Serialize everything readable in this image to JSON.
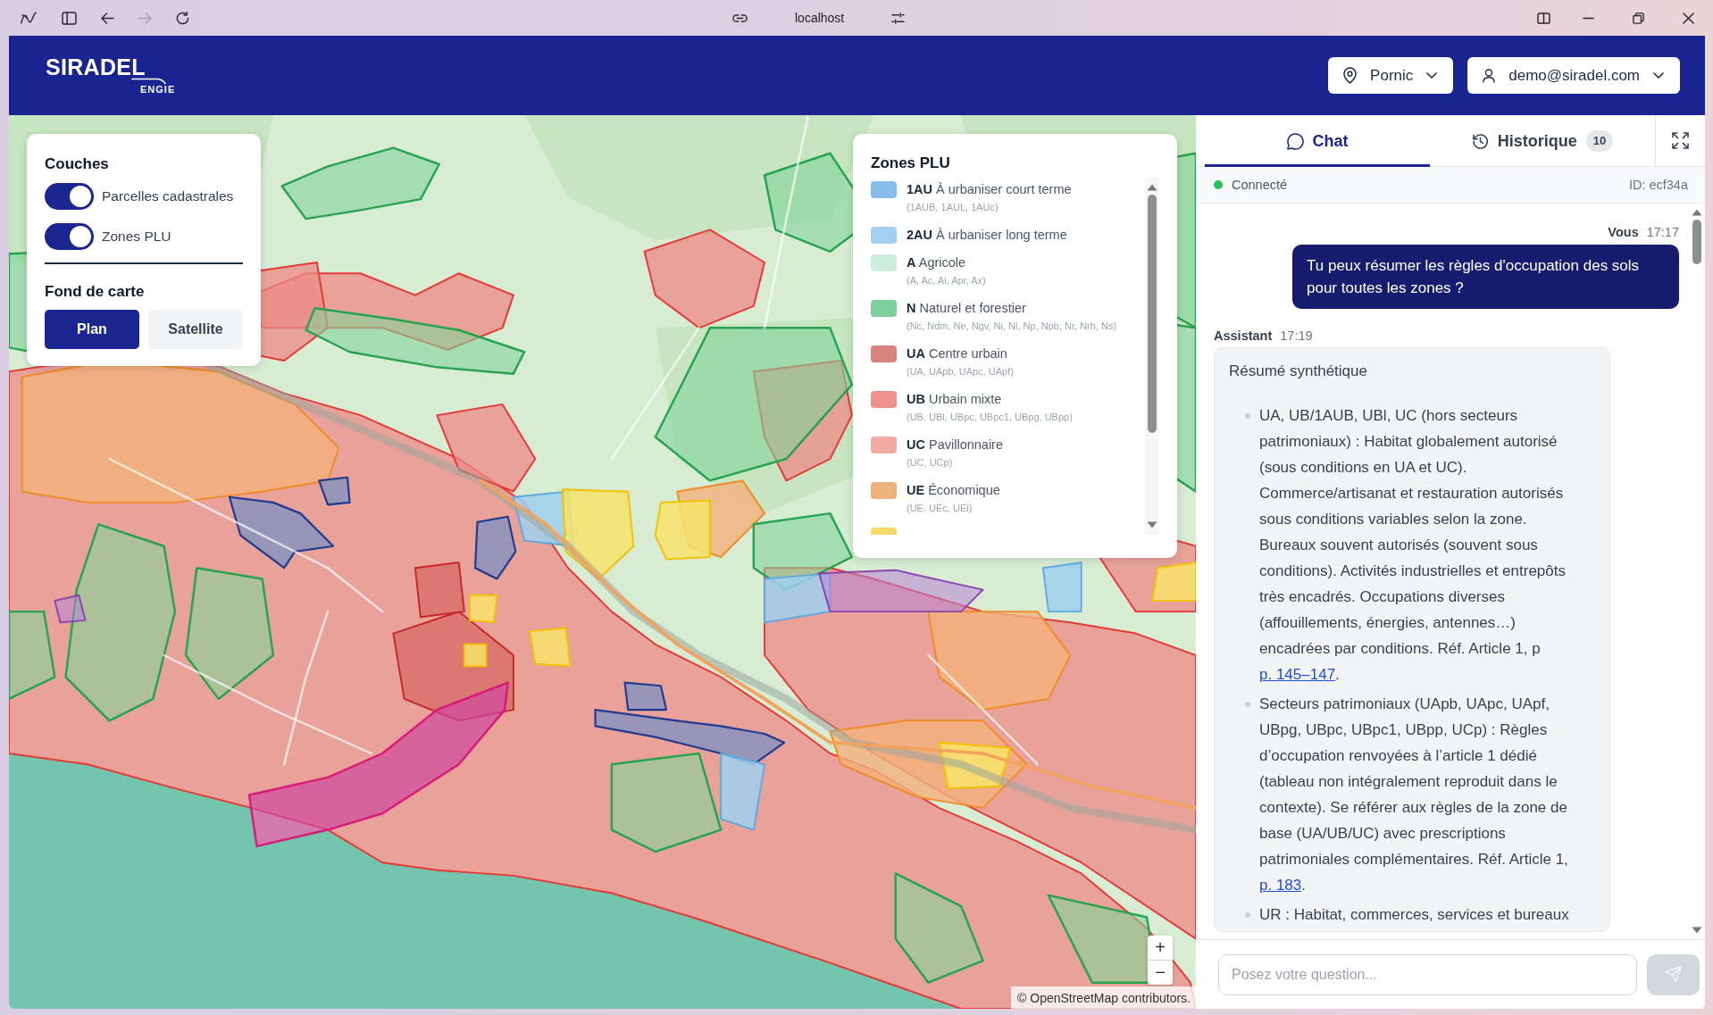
{
  "browser": {
    "address": "localhost",
    "can_go_forward": false
  },
  "header": {
    "logo": {
      "brand": "SIRADEL",
      "parent": "ENGIE"
    },
    "location": "Pornic",
    "user": "demo@siradel.com"
  },
  "layers_panel": {
    "title": "Couches",
    "layers": [
      {
        "label": "Parcelles cadastrales",
        "on": true
      },
      {
        "label": "Zones PLU",
        "on": true
      }
    ],
    "basemap_title": "Fond de carte",
    "basemaps": [
      {
        "label": "Plan",
        "selected": true
      },
      {
        "label": "Satellite",
        "selected": false
      }
    ]
  },
  "legend": {
    "title": "Zones PLU",
    "items": [
      {
        "label": "**1AU** À urbaniser court terme",
        "subzones": "(1AUB, 1AUL, 1AUc)",
        "color": "#86bee9"
      },
      {
        "label": "**2AU** À urbaniser long terme",
        "color": "#a3d0ef"
      },
      {
        "label": "**A** Agricole",
        "subzones": "(A, Ac, Ai, Apr, Ax)",
        "color": "#cdeedb"
      },
      {
        "label": "**N** Naturel et forestier",
        "subzones": "(Nc, Ndm, Ne, Ngv, Ni, Nl, Np, Npb, Nr, Nrh, Ns)",
        "color": "#7fcf9d"
      },
      {
        "label": "**UA** Centre urbain",
        "subzones": "(UA, UApb, UApc, UApf)",
        "color": "#d8847d"
      },
      {
        "label": "**UB** Urbain mixte",
        "subzones": "(UB, UBl, UBpc, UBpc1, UBpg, UBpp)",
        "color": "#ef918a"
      },
      {
        "label": "**UC** Pavillonnaire",
        "subzones": "(UC, UCp)",
        "color": "#f3aaa3"
      },
      {
        "label": "**UE** Économique",
        "subzones": "(UE, UEc, UEi)",
        "color": "#efb17b"
      },
      {
        "color": "#f6d86b"
      }
    ]
  },
  "map": {
    "zoom_in": "+",
    "zoom_out": "−",
    "attribution": "© OpenStreetMap contributors."
  },
  "chat": {
    "tabs": [
      {
        "kind": "chat",
        "label": "Chat",
        "selected": true
      },
      {
        "kind": "history",
        "label": "Historique",
        "badge": "10",
        "selected": false
      }
    ],
    "status": {
      "label": "Connecté",
      "connected": true,
      "session_id": "ID: ecf34a"
    },
    "messages": [
      {
        "kind": "user",
        "author": "Vous",
        "time": "17:17",
        "text": "Tu peux résumer les règles d'occupation des sols pour toutes les zones ?"
      },
      {
        "kind": "assistant",
        "author": "Assistant",
        "time": "17:19",
        "heading": "Résumé synthétique",
        "bullets": [
          {
            "text": "UA, UB/1AUB, UBl, UC (hors secteurs patrimoniaux) : Habitat globalement autorisé (sous conditions en UA et UC). Commerce/artisanat et restauration autorisés sous conditions variables selon la zone. Bureaux souvent autorisés (souvent sous conditions). Activités industrielles et entrepôts très encadrés. Occupations diverses (affouillements, énergies, antennes…) encadrées par conditions. Réf. Article 1, p",
            "link": "p. 145–147",
            "tail": "."
          },
          {
            "text": "Secteurs patrimoniaux (UApb, UApc, UApf, UBpg, UBpc, UBpc1, UBpp, UCp) : Règles d’occupation renvoyées à l’article 1 dédié (tableau non intégralement reproduit dans le contexte). Se référer aux règles de la zone de base (UA/UB/UC) avec prescriptions patrimoniales complémentaires. Réf. Article 1,",
            "link": "p. 183",
            "tail": "."
          },
          {
            "text": "UR : Habitat, commerces, services et bureaux"
          }
        ]
      }
    ],
    "input": {
      "placeholder": "Posez votre question..."
    },
    "send_button": {
      "disabled": true
    }
  }
}
